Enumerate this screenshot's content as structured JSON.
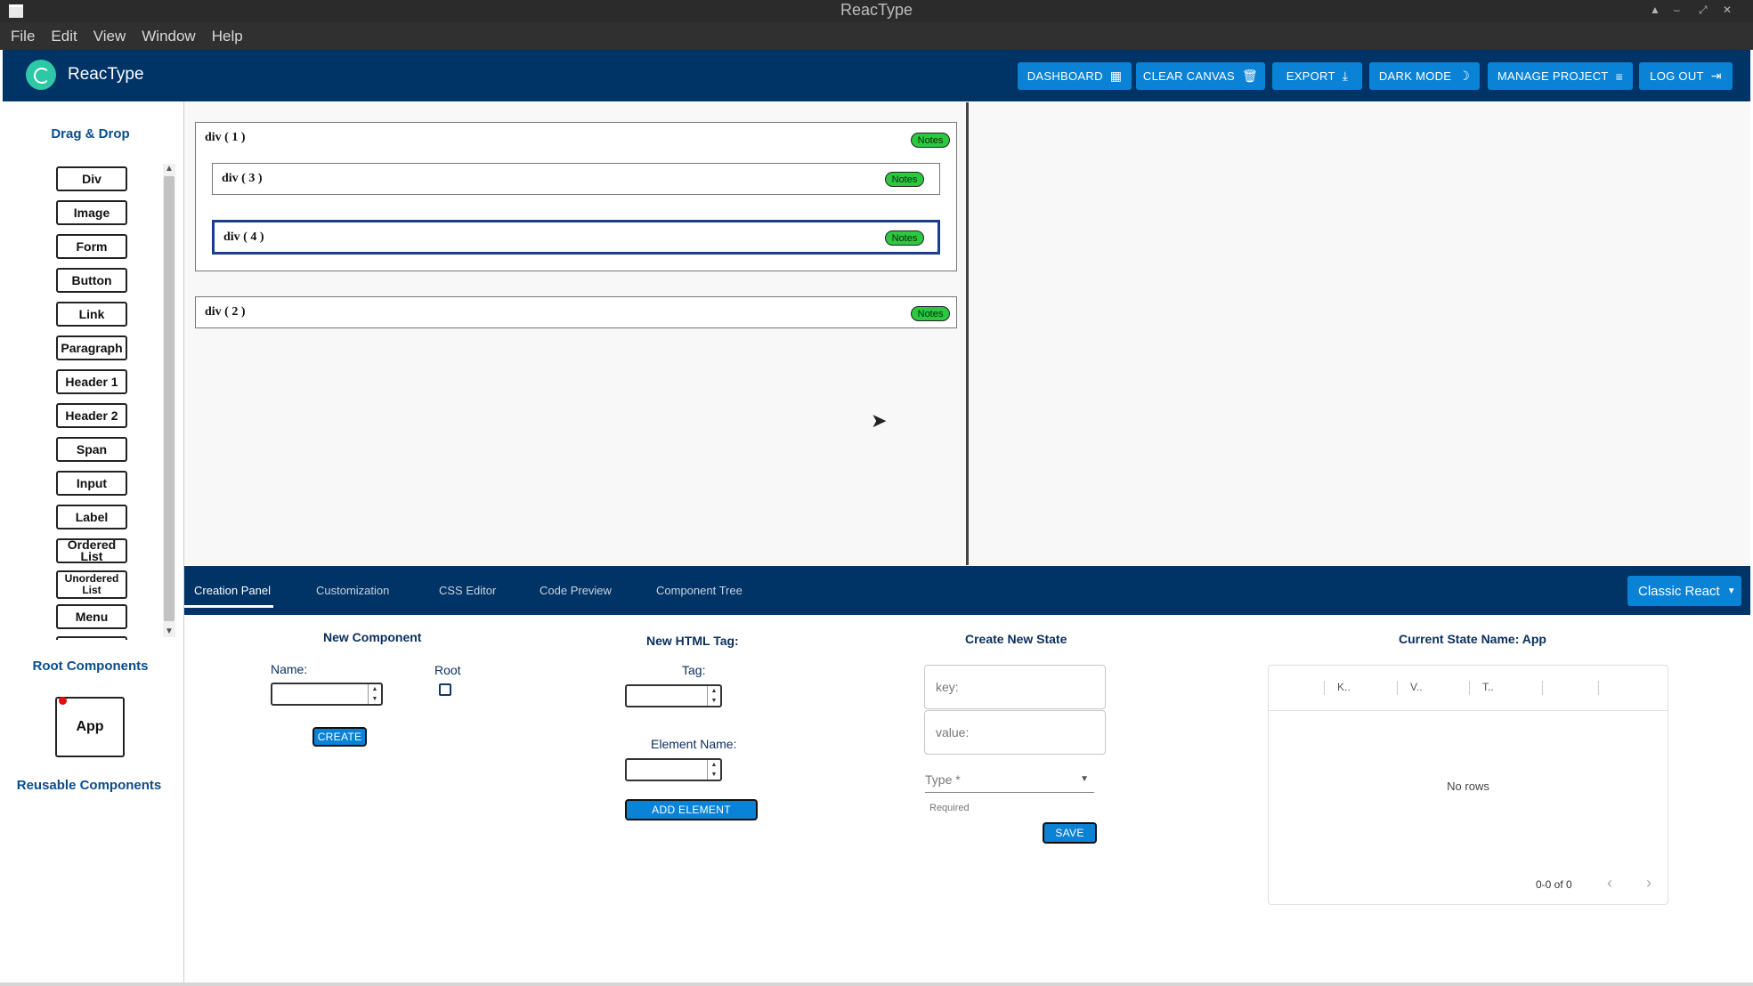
{
  "window": {
    "title": "ReacType"
  },
  "menu": [
    "File",
    "Edit",
    "View",
    "Window",
    "Help"
  ],
  "header": {
    "app_name": "ReacType",
    "buttons": [
      {
        "label": "DASHBOARD",
        "icon": "dashboard-icon"
      },
      {
        "label": "CLEAR CANVAS",
        "icon": "trash-icon"
      },
      {
        "label": "EXPORT",
        "icon": "download-icon"
      },
      {
        "label": "DARK MODE",
        "icon": "moon-icon"
      },
      {
        "label": "MANAGE PROJECT",
        "icon": "filter-icon"
      },
      {
        "label": "LOG OUT",
        "icon": "logout-icon"
      }
    ]
  },
  "sidebar": {
    "drag_drop_title": "Drag & Drop",
    "elements": [
      "Div",
      "Image",
      "Form",
      "Button",
      "Link",
      "Paragraph",
      "Header 1",
      "Header 2",
      "Span",
      "Input",
      "Label",
      "Ordered List",
      "Unordered List",
      "Menu"
    ],
    "root_title": "Root Components",
    "root_component": "App",
    "reusable_title": "Reusable Components"
  },
  "canvas": {
    "components": [
      {
        "label": "div ( 1 )",
        "notes": "Notes"
      },
      {
        "label": "div ( 3 )",
        "notes": "Notes"
      },
      {
        "label": "div ( 4 )",
        "notes": "Notes"
      },
      {
        "label": "div ( 2 )",
        "notes": "Notes"
      }
    ]
  },
  "tabs": {
    "items": [
      "Creation Panel",
      "Customization",
      "CSS Editor",
      "Code Preview",
      "Component Tree"
    ],
    "active": "Creation Panel",
    "framework": "Classic React"
  },
  "creation": {
    "new_component": {
      "title": "New Component",
      "name_label": "Name:",
      "root_label": "Root",
      "create_button": "CREATE"
    },
    "new_tag": {
      "title": "New HTML Tag:",
      "tag_label": "Tag:",
      "element_name_label": "Element Name:",
      "add_button": "ADD ELEMENT"
    },
    "new_state": {
      "title": "Create New State",
      "key_placeholder": "key:",
      "value_placeholder": "value:",
      "type_label": "Type *",
      "type_helper": "Required",
      "save_button": "SAVE"
    },
    "current_state": {
      "title": "Current State Name: App",
      "columns": [
        "K..",
        "V..",
        "T.."
      ],
      "empty_text": "No rows",
      "pagination": "0-0 of 0"
    }
  },
  "colors": {
    "header_bg": "#003366",
    "button_bg": "#0a82d6",
    "notes_green": "#2cc840",
    "accent_text": "#0a4d8c"
  }
}
